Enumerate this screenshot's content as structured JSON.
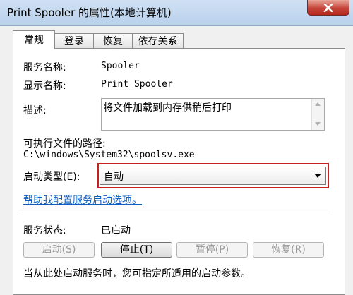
{
  "window": {
    "title": "Print Spooler 的属性(本地计算机)"
  },
  "tabs": [
    {
      "label": "常规"
    },
    {
      "label": "登录"
    },
    {
      "label": "恢复"
    },
    {
      "label": "依存关系"
    }
  ],
  "general": {
    "service_name_label": "服务名称:",
    "service_name_value": "Spooler",
    "display_name_label": "显示名称:",
    "display_name_value": "Print Spooler",
    "description_label": "描述:",
    "description_value": "将文件加载到内存供稍后打印",
    "path_label": "可执行文件的路径:",
    "path_value": "C:\\windows\\System32\\spoolsv.exe",
    "startup_type_label": "启动类型(E):",
    "startup_type_value": "自动",
    "help_link": "帮助我配置服务启动选项。",
    "status_label": "服务状态:",
    "status_value": "已启动",
    "buttons": {
      "start": "启动(S)",
      "stop": "停止(T)",
      "pause": "暂停(P)",
      "resume": "恢复(R)"
    },
    "footer_note": "当从此处启动服务时，您可指定所适用的启动参数。"
  },
  "colors": {
    "highlight_border": "#c61f1f",
    "link": "#0f5dbf",
    "close_button": "#c7453a"
  }
}
